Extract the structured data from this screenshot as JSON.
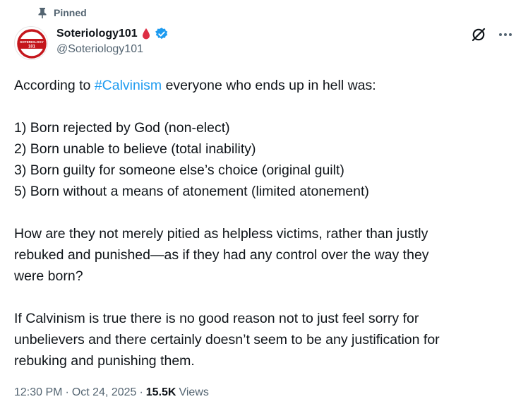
{
  "pinned": {
    "label": "Pinned"
  },
  "author": {
    "display_name": "Soteriology101",
    "handle": "@Soteriology101",
    "avatar_text_top": "SOTERIOLOGY",
    "avatar_text_bottom": "101"
  },
  "tweet": {
    "intro_before": "According to ",
    "hashtag": "#Calvinism",
    "intro_after": " everyone who ends up in hell was:",
    "list": [
      "1) Born rejected by God (non-elect)",
      "2) Born unable to believe (total inability)",
      "3) Born guilty for someone else’s choice (original guilt)",
      "5) Born without a means of atonement (limited atonement)"
    ],
    "para2": [
      "How are they not merely pitied as helpless victims, rather than justly",
      "rebuked and punished—as if they had any control over the way they",
      "were born?"
    ],
    "para3": [
      "If Calvinism is true there is no good reason not to just feel sorry for",
      "unbelievers and there certainly doesn’t seem to be any justification for",
      "rebuking and punishing them."
    ]
  },
  "meta": {
    "time": "12:30 PM",
    "separator": "·",
    "date": "Oct 24, 2025",
    "views_count": "15.5K",
    "views_label": "Views"
  },
  "icons": {
    "pin": "pin-icon",
    "drop": "blood-drop-icon",
    "verified": "verified-badge-icon",
    "grok": "grok-icon",
    "more": "more-icon"
  },
  "colors": {
    "text_primary": "#0f1419",
    "text_secondary": "#536471",
    "accent": "#1d9bf0",
    "drop_red": "#dd2e44",
    "avatar_red": "#c4161c"
  }
}
